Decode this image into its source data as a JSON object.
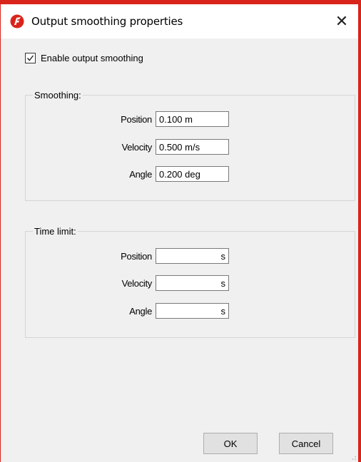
{
  "window": {
    "title": "Output smoothing properties",
    "close_symbol": "✕"
  },
  "icons": {
    "app": "app-logo-icon",
    "close": "close-icon",
    "check": "checkmark-icon"
  },
  "enable_checkbox": {
    "label": "Enable output smoothing",
    "checked": true
  },
  "smoothing": {
    "legend": "Smoothing:",
    "fields": [
      {
        "label": "Position",
        "value": "0.100 m"
      },
      {
        "label": "Velocity",
        "value": "0.500 m/s"
      },
      {
        "label": "Angle",
        "value": "0.200 deg"
      }
    ]
  },
  "time_limit": {
    "legend": "Time limit:",
    "fields": [
      {
        "label": "Position",
        "value": "s"
      },
      {
        "label": "Velocity",
        "value": "s"
      },
      {
        "label": "Angle",
        "value": "s"
      }
    ]
  },
  "buttons": {
    "ok": "OK",
    "cancel": "Cancel"
  },
  "colors": {
    "accent_border": "#d9241b",
    "dialog_bg": "#f0f0f0"
  }
}
